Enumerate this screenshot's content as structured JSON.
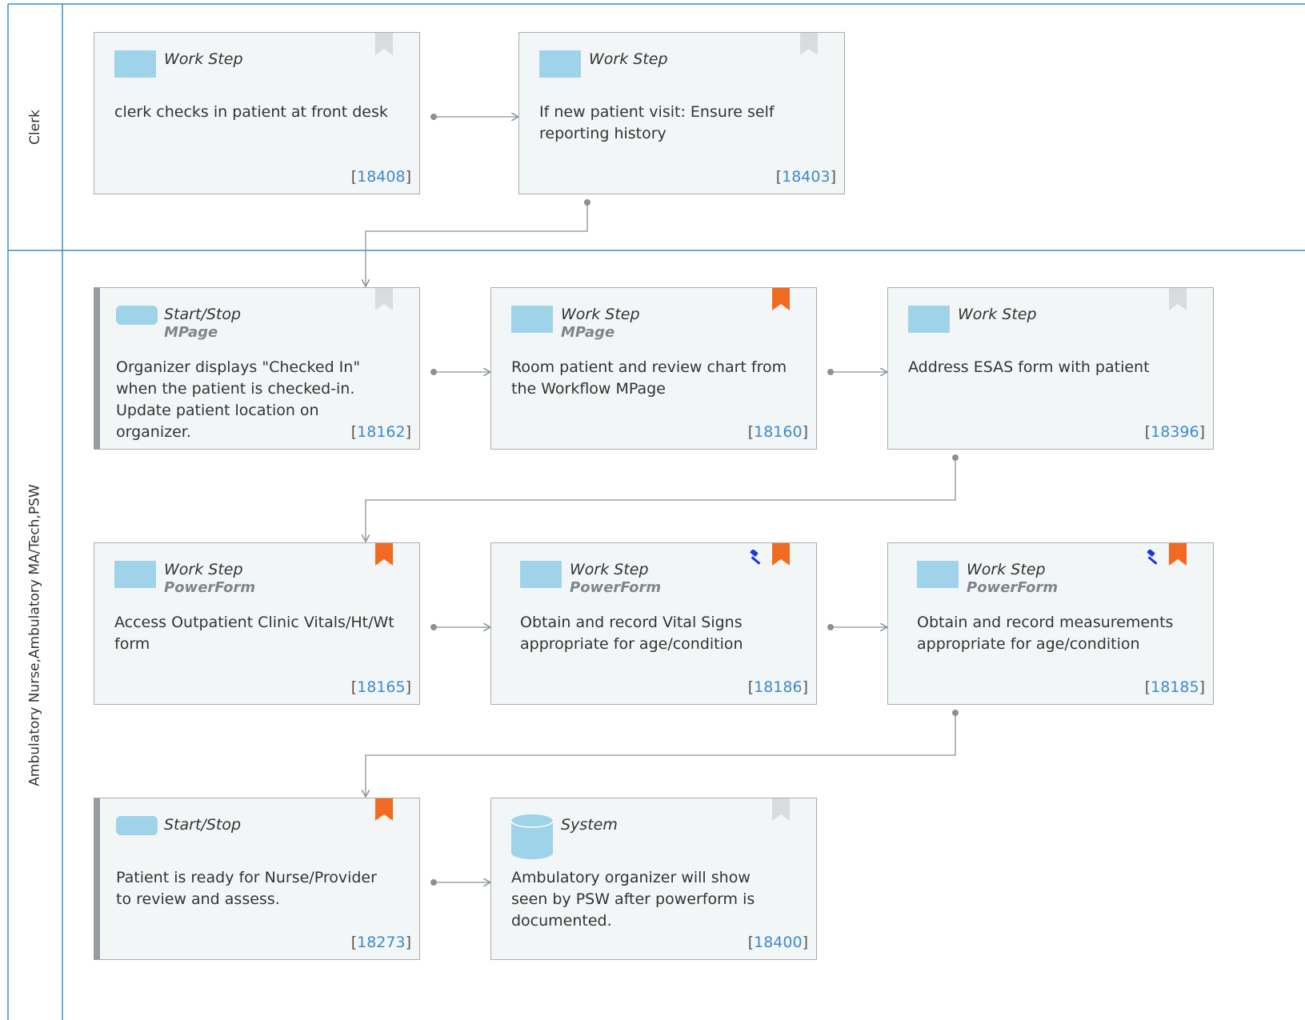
{
  "lanes": [
    {
      "label": "Clerk"
    },
    {
      "label": "Ambulatory Nurse,Ambulatory MA/Tech,PSW"
    }
  ],
  "colors": {
    "lane_border": "#3c8dc7",
    "bookmark_active": "#f26a22",
    "bookmark_inactive": "#d8dcde",
    "shape_fill": "#9fd3ea",
    "id_link": "#3d8bc7",
    "gavel": "#1a3bd8",
    "connector": "#8a9196"
  },
  "steps": [
    {
      "id": "18408",
      "type": "Work Step",
      "subtype": "",
      "text": "clerk checks in patient at front desk",
      "bookmark": "inactive",
      "icon": "work-step",
      "gavel": false
    },
    {
      "id": "18403",
      "type": "Work Step",
      "subtype": "",
      "text": "If new patient visit: Ensure self reporting history",
      "bookmark": "inactive",
      "icon": "work-step",
      "gavel": false
    },
    {
      "id": "18162",
      "type": "Start/Stop",
      "subtype": "MPage",
      "text": "Organizer displays \"Checked In\" when the patient is checked-in. Update patient location on organizer.",
      "bookmark": "inactive",
      "icon": "start-stop",
      "gavel": false
    },
    {
      "id": "18160",
      "type": "Work Step",
      "subtype": "MPage",
      "text": "Room patient and review chart from the Workflow MPage",
      "bookmark": "active",
      "icon": "work-step",
      "gavel": false
    },
    {
      "id": "18396",
      "type": "Work Step",
      "subtype": "",
      "text": "Address ESAS form with patient",
      "bookmark": "inactive",
      "icon": "work-step",
      "gavel": false
    },
    {
      "id": "18165",
      "type": "Work Step",
      "subtype": "PowerForm",
      "text": "Access Outpatient Clinic Vitals/Ht/Wt form",
      "bookmark": "active",
      "icon": "work-step",
      "gavel": false
    },
    {
      "id": "18186",
      "type": "Work Step",
      "subtype": "PowerForm",
      "text": "Obtain and record Vital Signs appropriate for age/condition",
      "bookmark": "active",
      "icon": "work-step",
      "gavel": true
    },
    {
      "id": "18185",
      "type": "Work Step",
      "subtype": "PowerForm",
      "text": "Obtain and record measurements appropriate for age/condition",
      "bookmark": "active",
      "icon": "work-step",
      "gavel": true
    },
    {
      "id": "18273",
      "type": "Start/Stop",
      "subtype": "",
      "text": "Patient is ready for Nurse/Provider to review and assess.",
      "bookmark": "active",
      "icon": "start-stop",
      "gavel": false
    },
    {
      "id": "18400",
      "type": "System",
      "subtype": "",
      "text": "Ambulatory organizer will show seen by PSW after powerform is documented.",
      "bookmark": "inactive",
      "icon": "database-icon",
      "gavel": false
    }
  ]
}
